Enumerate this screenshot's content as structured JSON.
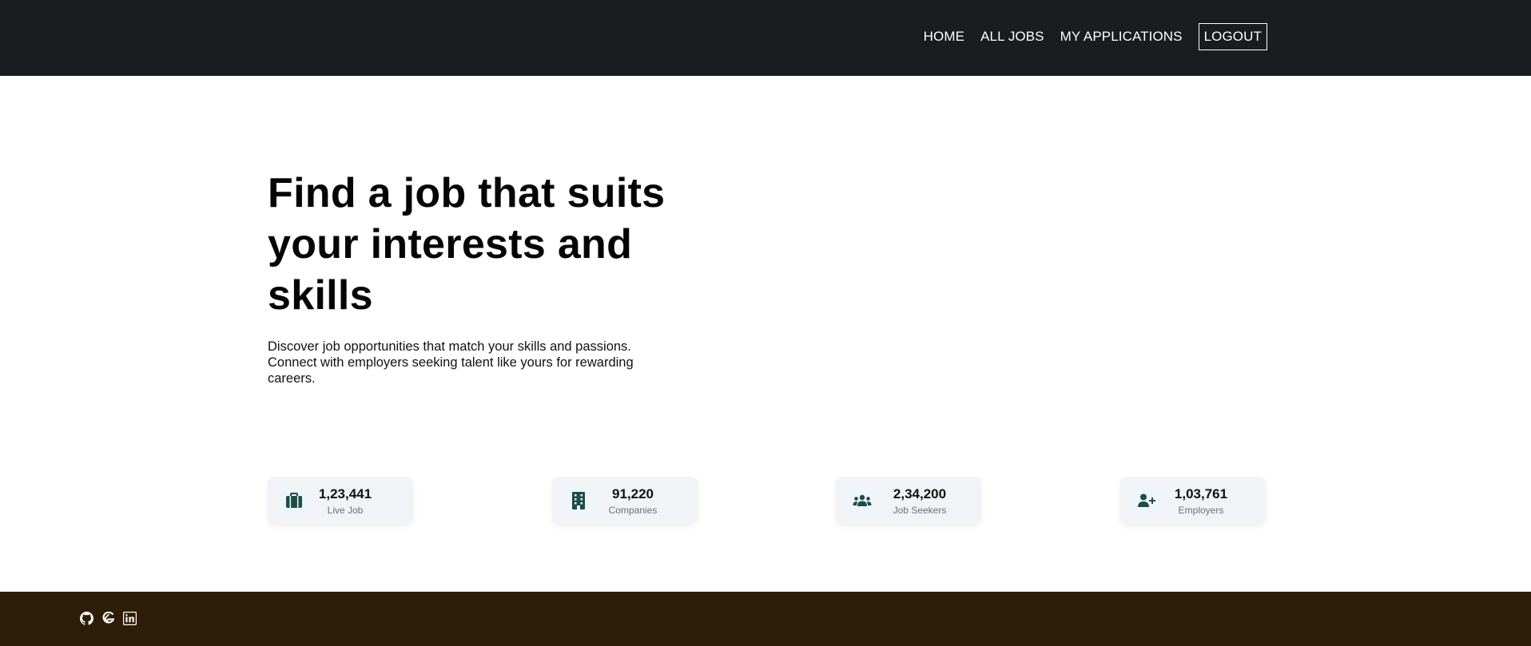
{
  "nav": {
    "home": "HOME",
    "all_jobs": "ALL JOBS",
    "my_applications": "MY APPLICATIONS",
    "logout": "LOGOUT"
  },
  "hero": {
    "title_line1": "Find a job that suits",
    "title_line2": "your interests and",
    "title_line3": "skills",
    "description": "Discover job opportunities that match your skills and passions. Connect with employers seeking talent like yours for rewarding careers."
  },
  "stats": [
    {
      "value": "1,23,441",
      "label": "Live Job",
      "icon": "briefcase-icon"
    },
    {
      "value": "91,220",
      "label": "Companies",
      "icon": "building-icon"
    },
    {
      "value": "2,34,200",
      "label": "Job Seekers",
      "icon": "users-icon"
    },
    {
      "value": "1,03,761",
      "label": "Employers",
      "icon": "user-plus-icon"
    }
  ],
  "footer": {
    "icons": [
      "github-icon",
      "geeksforgeeks-icon",
      "linkedin-icon"
    ]
  },
  "colors": {
    "navbar_bg": "#1b1c20",
    "footer_bg": "#2e1e07",
    "icon_color": "#1f4d48",
    "stat_card_bg": "#f1f3f6"
  }
}
